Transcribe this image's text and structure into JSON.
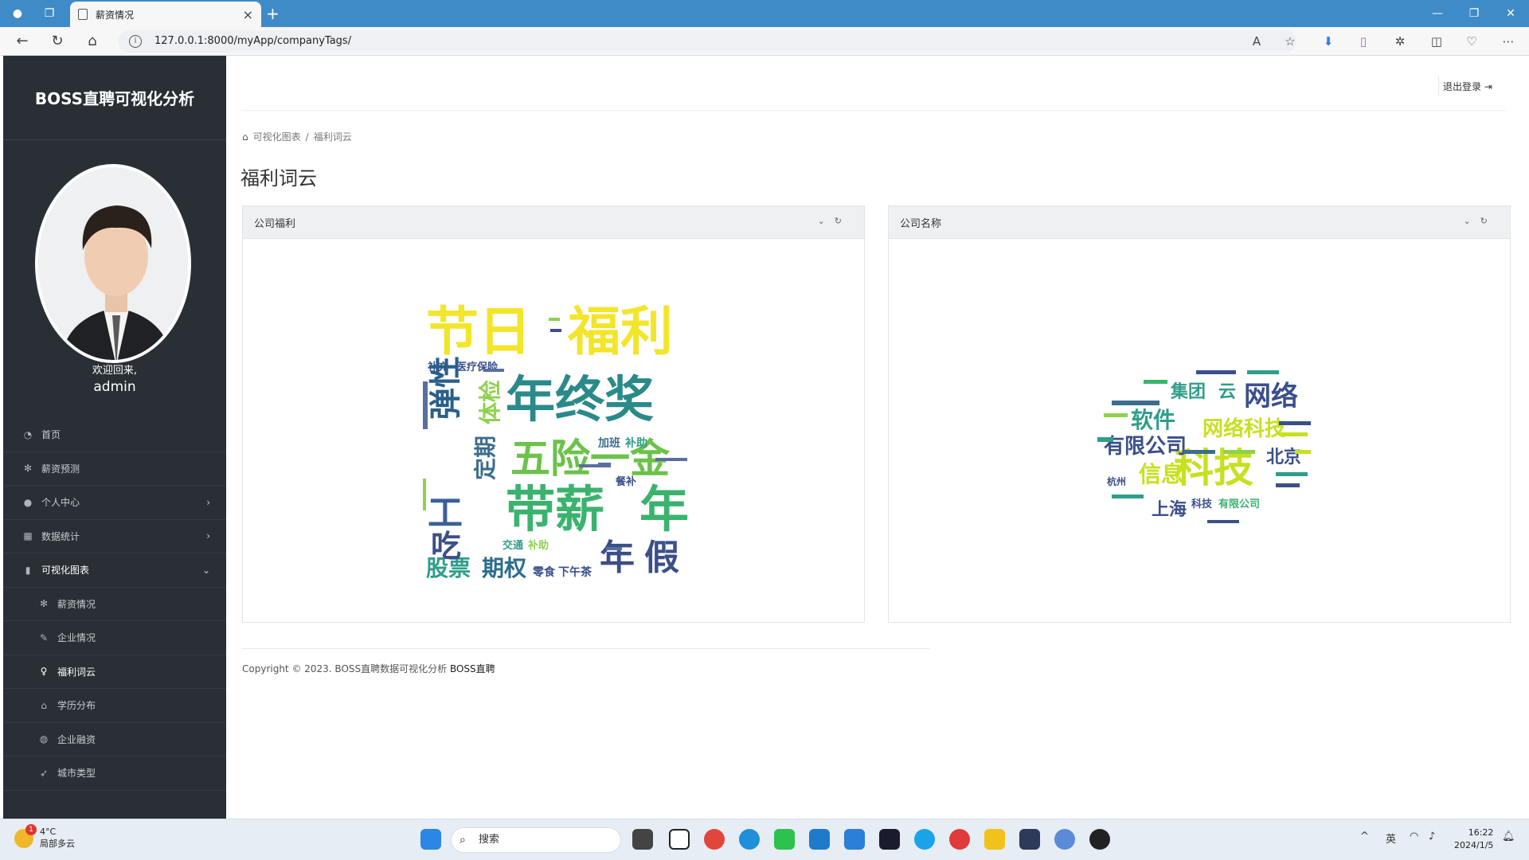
{
  "browser": {
    "tab_title": "薪资情况",
    "url": "127.0.0.1:8000/myApp/companyTags/"
  },
  "sidebar": {
    "brand": "BOSS直聘可视化分析",
    "welcome": "欢迎回来,",
    "username": "admin",
    "items": [
      {
        "label": "首页",
        "icon": "dashboard-icon"
      },
      {
        "label": "薪资预测",
        "icon": "gear-icon"
      },
      {
        "label": "个人中心",
        "icon": "user-icon"
      },
      {
        "label": "数据统计",
        "icon": "grid-icon"
      },
      {
        "label": "可视化图表",
        "icon": "bar-chart-icon"
      },
      {
        "label": "薪资情况",
        "icon": "gear-icon"
      },
      {
        "label": "企业情况",
        "icon": "feather-icon"
      },
      {
        "label": "福利词云",
        "icon": "lightbulb-icon"
      },
      {
        "label": "学历分布",
        "icon": "graduation-cap-icon"
      },
      {
        "label": "企业融资",
        "icon": "globe-icon"
      },
      {
        "label": "城市类型",
        "icon": "rocket-icon"
      }
    ]
  },
  "header": {
    "logout": "退出登录"
  },
  "breadcrumb": {
    "root": "可视化图表",
    "current": "福利词云"
  },
  "page_title": "福利词云",
  "panels": [
    {
      "title": "公司福利"
    },
    {
      "title": "公司名称"
    }
  ],
  "clouds": {
    "welfare": [
      {
        "t": "节日",
        "c": "#f3e52a"
      },
      {
        "t": "福利",
        "c": "#f3e52a"
      },
      {
        "t": "年终奖",
        "c": "#2a8a8a"
      },
      {
        "t": "五险一金",
        "c": "#6cc24a"
      },
      {
        "t": "带薪",
        "c": "#3bb36e"
      },
      {
        "t": "年",
        "c": "#3bb36e"
      },
      {
        "t": "年",
        "c": "#3b4f8a"
      },
      {
        "t": "假",
        "c": "#3b4f8a"
      },
      {
        "t": "股票",
        "c": "#2f9e8a"
      },
      {
        "t": "期权",
        "c": "#2c6e8e"
      },
      {
        "t": "体检",
        "c": "#8fd14f"
      },
      {
        "t": "定期",
        "c": "#3b6e8e"
      },
      {
        "t": "零食",
        "c": "#3b4f8a"
      },
      {
        "t": "下午茶",
        "c": "#3b4f8a"
      },
      {
        "t": "加班",
        "c": "#3b6e8e"
      },
      {
        "t": "补助",
        "c": "#2f9e8a"
      },
      {
        "t": "补充",
        "c": "#3b4f8a"
      },
      {
        "t": "医疗保险",
        "c": "#3b4f8a"
      },
      {
        "t": "交通",
        "c": "#2f9e8a"
      },
      {
        "t": "补助",
        "c": "#8fd14f"
      },
      {
        "t": "餐补",
        "c": "#3b4f8a"
      }
    ],
    "company": [
      {
        "t": "科技",
        "c": "#c8e020"
      },
      {
        "t": "网络科技",
        "c": "#c8e020"
      },
      {
        "t": "有限公司",
        "c": "#3b4f8a"
      },
      {
        "t": "信息",
        "c": "#c8e020"
      },
      {
        "t": "网络",
        "c": "#3b4f8a"
      },
      {
        "t": "软件",
        "c": "#2f9e8a"
      },
      {
        "t": "北京",
        "c": "#3b4f8a"
      },
      {
        "t": "上海",
        "c": "#3b4f8a"
      },
      {
        "t": "集团",
        "c": "#2f9e8a"
      },
      {
        "t": "云",
        "c": "#2f9e8a"
      },
      {
        "t": "杭州",
        "c": "#3b4f8a"
      },
      {
        "t": "科技",
        "c": "#3b4f8a"
      },
      {
        "t": "有限公司",
        "c": "#3bb36e"
      }
    ]
  },
  "footer": {
    "text": "Copyright © 2023. BOSS直聘数据可视化分析",
    "brand": "BOSS直聘"
  },
  "taskbar": {
    "weather_temp": "4°C",
    "weather_desc": "局部多云",
    "weather_badge": "1",
    "search": "搜索",
    "ime": "英",
    "time": "16:22",
    "date": "2024/1/5"
  }
}
